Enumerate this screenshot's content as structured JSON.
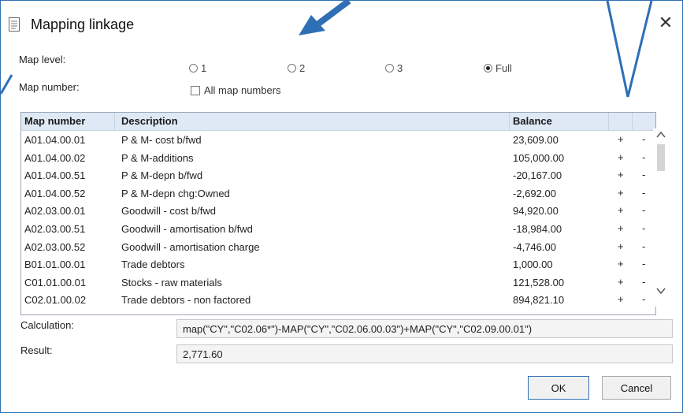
{
  "window": {
    "title": "Mapping linkage",
    "title_icon": "document-icon",
    "close_glyph": "✕"
  },
  "map_level": {
    "label": "Map level:",
    "options": [
      {
        "label": "1",
        "selected": false
      },
      {
        "label": "2",
        "selected": false
      },
      {
        "label": "3",
        "selected": false
      },
      {
        "label": "Full",
        "selected": true
      }
    ]
  },
  "map_number": {
    "label": "Map number:",
    "all_label": "All map numbers",
    "all_checked": false
  },
  "table": {
    "columns": [
      "Map number",
      "Description",
      "Balance"
    ],
    "rows": [
      {
        "map": "A01.04.00.01",
        "desc": "P & M- cost b/fwd",
        "balance": "23,609.00"
      },
      {
        "map": "A01.04.00.02",
        "desc": "P & M-additions",
        "balance": "105,000.00"
      },
      {
        "map": "A01.04.00.51",
        "desc": "P & M-depn b/fwd",
        "balance": "-20,167.00"
      },
      {
        "map": "A01.04.00.52",
        "desc": "P & M-depn chg:Owned",
        "balance": "-2,692.00"
      },
      {
        "map": "A02.03.00.01",
        "desc": "Goodwill - cost b/fwd",
        "balance": "94,920.00"
      },
      {
        "map": "A02.03.00.51",
        "desc": "Goodwill - amortisation b/fwd",
        "balance": "-18,984.00"
      },
      {
        "map": "A02.03.00.52",
        "desc": "Goodwill - amortisation charge",
        "balance": "-4,746.00"
      },
      {
        "map": "B01.01.00.01",
        "desc": "Trade debtors",
        "balance": "1,000.00"
      },
      {
        "map": "C01.01.00.01",
        "desc": "Stocks - raw materials",
        "balance": "121,528.00"
      },
      {
        "map": "C02.01.00.02",
        "desc": "Trade debtors - non factored",
        "balance": "894,821.10"
      }
    ],
    "plus_glyph": "+",
    "minus_glyph": "-"
  },
  "calculation": {
    "label": "Calculation:",
    "value": "map(\"CY\",\"C02.06*\")-MAP(\"CY\",\"C02.06.00.03\")+MAP(\"CY\",\"C02.09.00.01\")"
  },
  "result": {
    "label": "Result:",
    "value": "2,771.60"
  },
  "buttons": {
    "ok": "OK",
    "cancel": "Cancel"
  },
  "colors": {
    "accent": "#2f6fb5",
    "header_bg": "#dfe8f5"
  }
}
